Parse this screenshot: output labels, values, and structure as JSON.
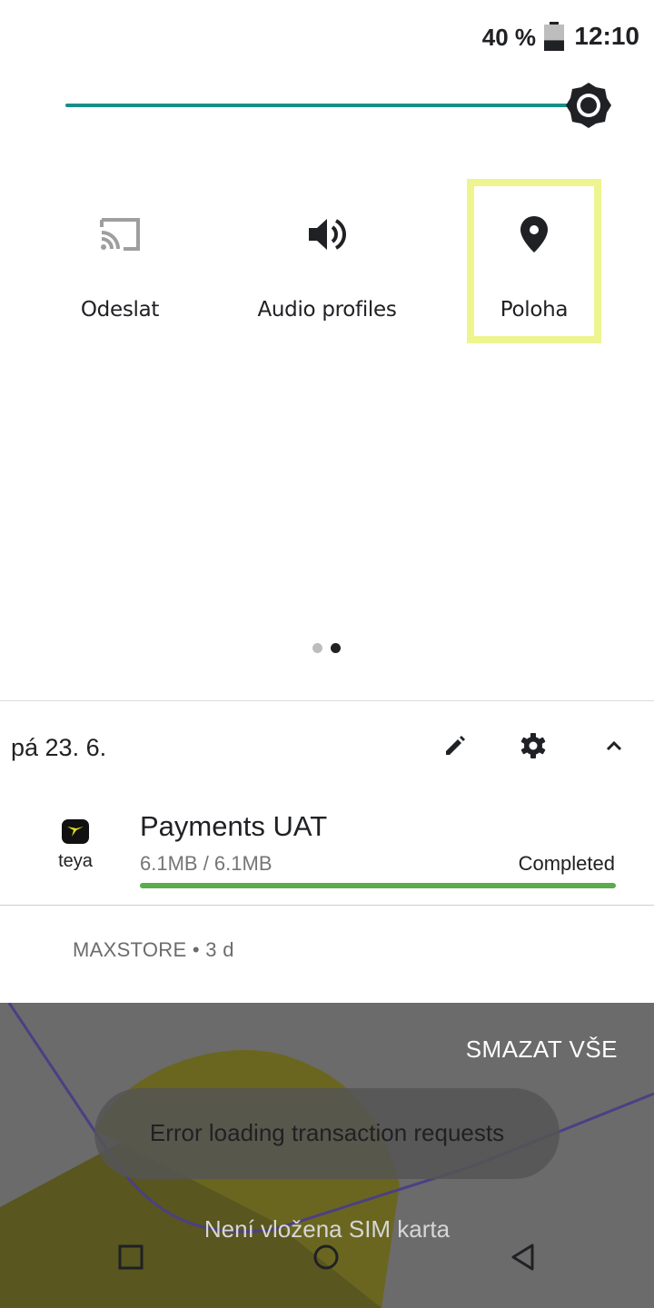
{
  "status_bar": {
    "battery": "40 %",
    "battery_level": 0.4,
    "time": "12:10"
  },
  "brightness": {
    "level": 0.97
  },
  "tiles": [
    {
      "label": "Odeslat",
      "icon": "cast-icon",
      "active": false
    },
    {
      "label": "Audio profiles",
      "icon": "volume-icon",
      "active": false
    },
    {
      "label": "Poloha",
      "icon": "location-pin-icon",
      "active": true
    }
  ],
  "page_dots": {
    "count": 2,
    "current": 2
  },
  "date_row": {
    "date": "pá 23. 6."
  },
  "notification": {
    "app": "teya",
    "title": "Payments UAT",
    "size": "6.1MB / 6.1MB",
    "status": "Completed",
    "progress": 1.0
  },
  "notification2": {
    "text": "MAXSTORE • 3 d"
  },
  "wallpaper": {
    "clear_all": "SMAZAT VŠE",
    "toast": "Error loading transaction requests",
    "sim_status": "Není vložena SIM karta"
  },
  "colors": {
    "accent": "#188f86",
    "highlight": "#eef58f",
    "progress": "#5aac4d",
    "teya_yellow": "#e8e21a"
  }
}
